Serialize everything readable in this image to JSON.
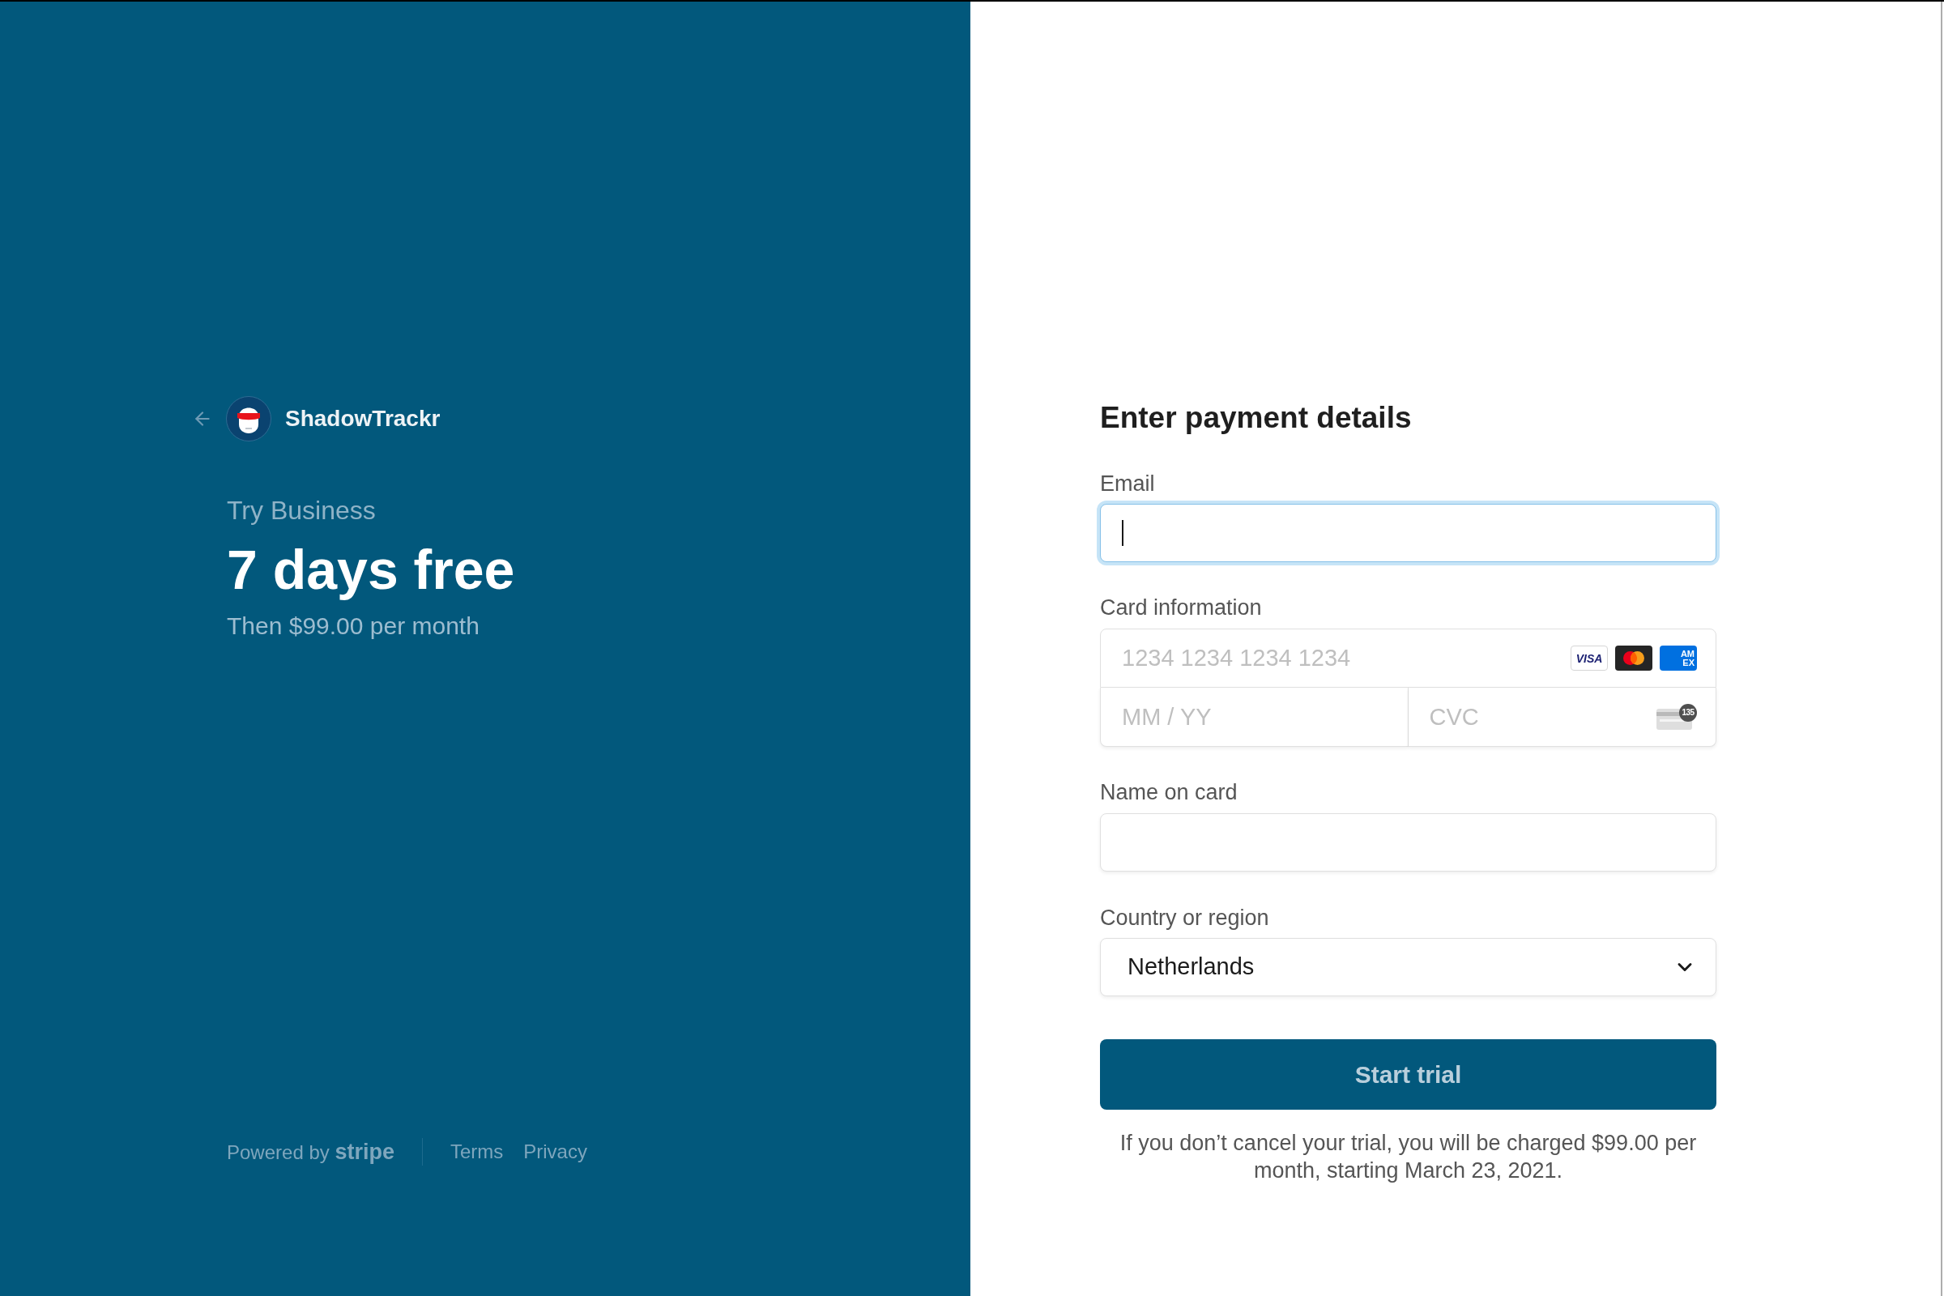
{
  "brand_panel": {
    "brand_name": "ShadowTrackr",
    "plan_label": "Try Business",
    "trial_headline": "7 days free",
    "price_note": "Then $99.00 per month",
    "footer": {
      "powered_by": "Powered by **stripe**",
      "links": [
        "Terms",
        "Privacy"
      ]
    }
  },
  "payment_form": {
    "title": "Enter payment details",
    "email": {
      "label": "Email",
      "focused": true
    },
    "card": {
      "label": "Card information",
      "number": {
        "placeholder": "1234 1234 1234 1234"
      },
      "brand_icons": [
        {
          "kind": "visa",
          "text": "VISA"
        },
        {
          "kind": "mastercard"
        },
        {
          "kind": "amex",
          "lines": [
            "AM",
            "EX"
          ]
        }
      ],
      "expiry": {
        "placeholder": "MM / YY"
      },
      "cvc": {
        "placeholder": "CVC",
        "icon_text": "135"
      }
    },
    "name_on_card": {
      "label": "Name on card"
    },
    "country": {
      "label": "Country or region",
      "value": "Netherlands"
    },
    "submit_button": "Start trial",
    "disclaimer": "If you don’t cancel your trial, you will be charged $99.00 per month, starting March 23, 2021."
  }
}
